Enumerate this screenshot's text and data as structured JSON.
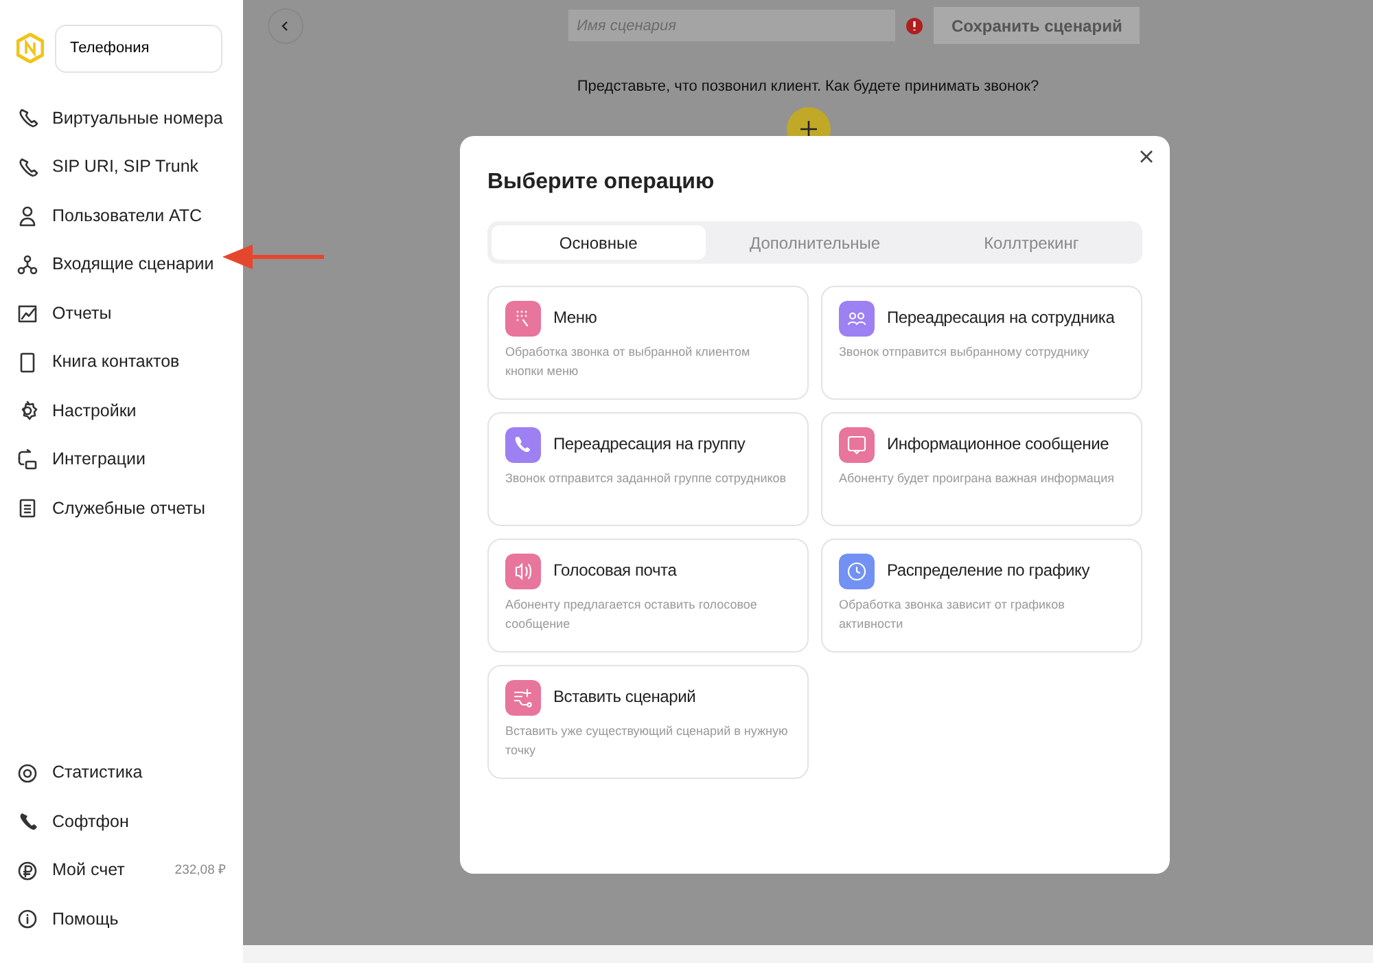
{
  "sidebar": {
    "section_select": "Телефония",
    "items": [
      {
        "label": "Виртуальные номера"
      },
      {
        "label": "SIP URI, SIP Trunk"
      },
      {
        "label": "Пользователи АТС"
      },
      {
        "label": "Входящие сценарии"
      },
      {
        "label": "Отчеты"
      },
      {
        "label": "Книга контактов"
      },
      {
        "label": "Настройки"
      },
      {
        "label": "Интеграции"
      },
      {
        "label": "Служебные отчеты"
      }
    ],
    "bottom_items": [
      {
        "label": "Статистика"
      },
      {
        "label": "Софтфон"
      },
      {
        "label": "Мой счет",
        "value": "232,08 ₽"
      },
      {
        "label": "Помощь"
      }
    ]
  },
  "toolbar": {
    "name_field": {
      "placeholder": "Имя сценария"
    },
    "save_button": "Сохранить сценарий"
  },
  "canvas": {
    "prompt": "Представьте, что позвонил клиент. Как будете принимать звонок?"
  },
  "modal": {
    "title": "Выберите операцию",
    "tabs": [
      {
        "label": "Основные",
        "selected": true
      },
      {
        "label": "Дополнительные",
        "selected": false
      },
      {
        "label": "Коллтрекинг",
        "selected": false
      }
    ],
    "operations": [
      {
        "title": "Меню",
        "description": "Обработка звонка от выбранной клиентом кнопки меню",
        "color": "#e8759b"
      },
      {
        "title": "Переадресация на сотрудника",
        "description": "Звонок отправится выбранному сотруднику",
        "color": "#9d80f1"
      },
      {
        "title": "Переадресация на группу",
        "description": "Звонок отправится заданной группе сотрудников",
        "color": "#9d80f1"
      },
      {
        "title": "Информационное сообщение",
        "description": "Абоненту будет проиграна важная информация",
        "color": "#e8759b"
      },
      {
        "title": "Голосовая почта",
        "description": "Абоненту предлагается оставить голосовое сообщение",
        "color": "#e8759b"
      },
      {
        "title": "Распределение по графику",
        "description": "Обработка звонка зависит от графиков активности",
        "color": "#7391f3"
      },
      {
        "title": "Вставить сценарий",
        "description": "Вставить уже существующий сценарий в нужную точку",
        "color": "#e8759b"
      }
    ]
  }
}
